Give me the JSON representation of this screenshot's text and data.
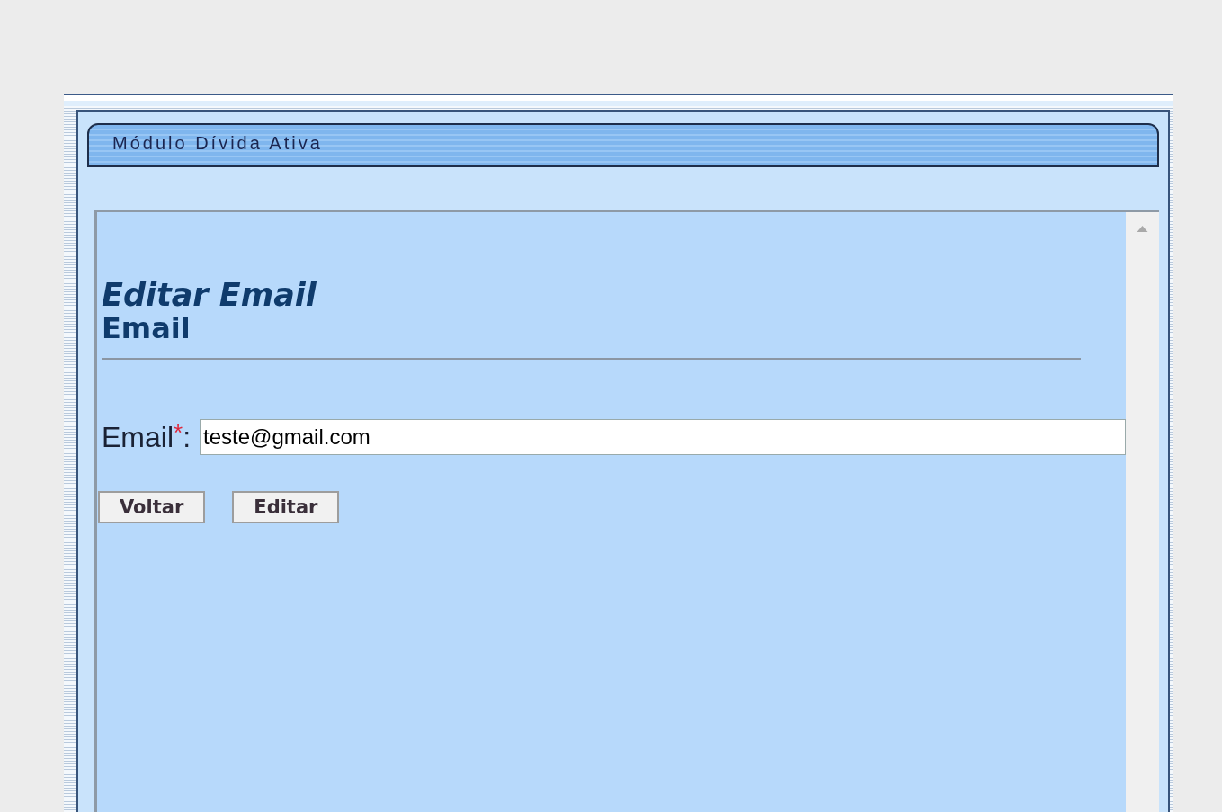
{
  "module_header": {
    "title": "Módulo Dívida Ativa"
  },
  "form": {
    "title": "Editar Email",
    "subtitle": "Email",
    "field": {
      "label": "Email",
      "required_mark": "*",
      "suffix": ":",
      "value": "teste@gmail.com"
    },
    "buttons": [
      "Voltar",
      "Editar"
    ]
  }
}
